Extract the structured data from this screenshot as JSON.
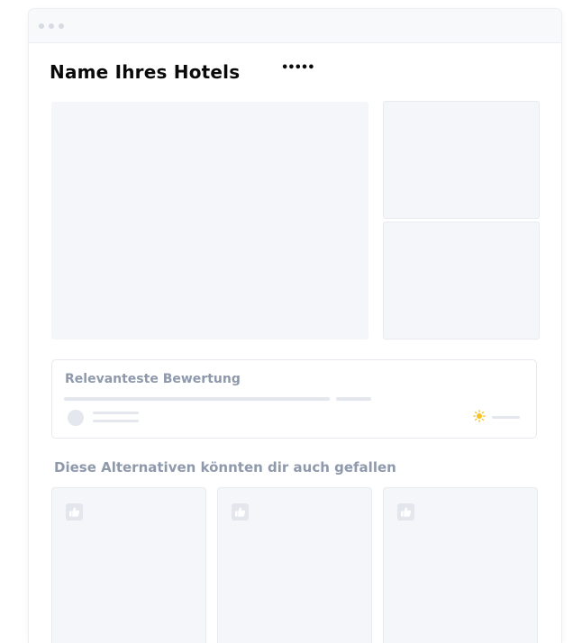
{
  "hotel": {
    "name": "Name Ihres Hotels",
    "rating_stars": "•••••"
  },
  "review": {
    "title": "Relevanteste Bewertung"
  },
  "alternatives": {
    "heading": "Diese Alternativen könnten dir auch gefallen",
    "cards": [
      {
        "icon": "thumbs-up-icon"
      },
      {
        "icon": "thumbs-up-icon"
      },
      {
        "icon": "thumbs-up-icon"
      }
    ]
  },
  "colors": {
    "placeholder": "#f5f6f9",
    "muted_text": "#8f99ac",
    "sun_accent": "#f5c125"
  }
}
